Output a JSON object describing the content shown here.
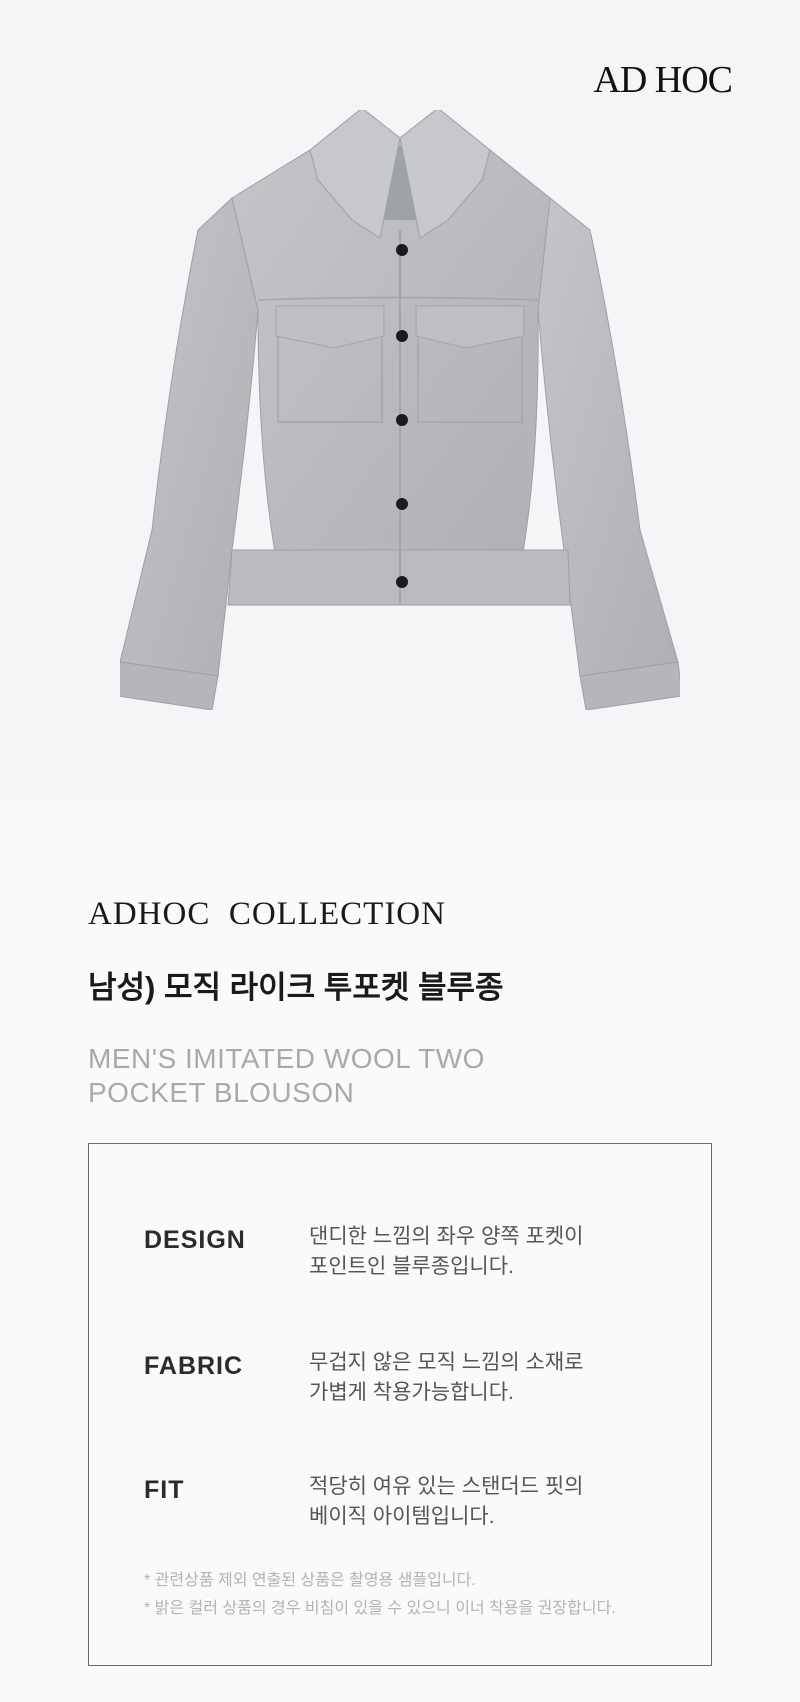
{
  "brand": {
    "logo_text": "AD HOC"
  },
  "product_image": {
    "alt": "grey wool two pocket jacket",
    "color": "#b7b9bd"
  },
  "collection_label": "ADHOC  COLLECTION",
  "title_ko": "남성) 모직 라이크 투포켓 블루종",
  "title_en": "MEN'S IMITATED WOOL TWO POCKET BLOUSON",
  "specs": [
    {
      "label": "DESIGN",
      "lines": [
        "댄디한 느낌의 좌우 양쪽 포켓이",
        "포인트인 블루종입니다."
      ]
    },
    {
      "label": "FABRIC",
      "lines": [
        "무겁지 않은 모직 느낌의 소재로",
        "가볍게 착용가능합니다."
      ]
    },
    {
      "label": "FIT",
      "lines": [
        "적당히 여유 있는 스탠더드 핏의",
        "베이직 아이템입니다."
      ]
    }
  ],
  "notes": [
    "* 관련상품 제외 연출된 상품은 촬영용 샘플입니다.",
    "* 밝은 컬러 상품의 경우 비침이 있을 수 있으니 이너 착용을 권장합니다."
  ]
}
